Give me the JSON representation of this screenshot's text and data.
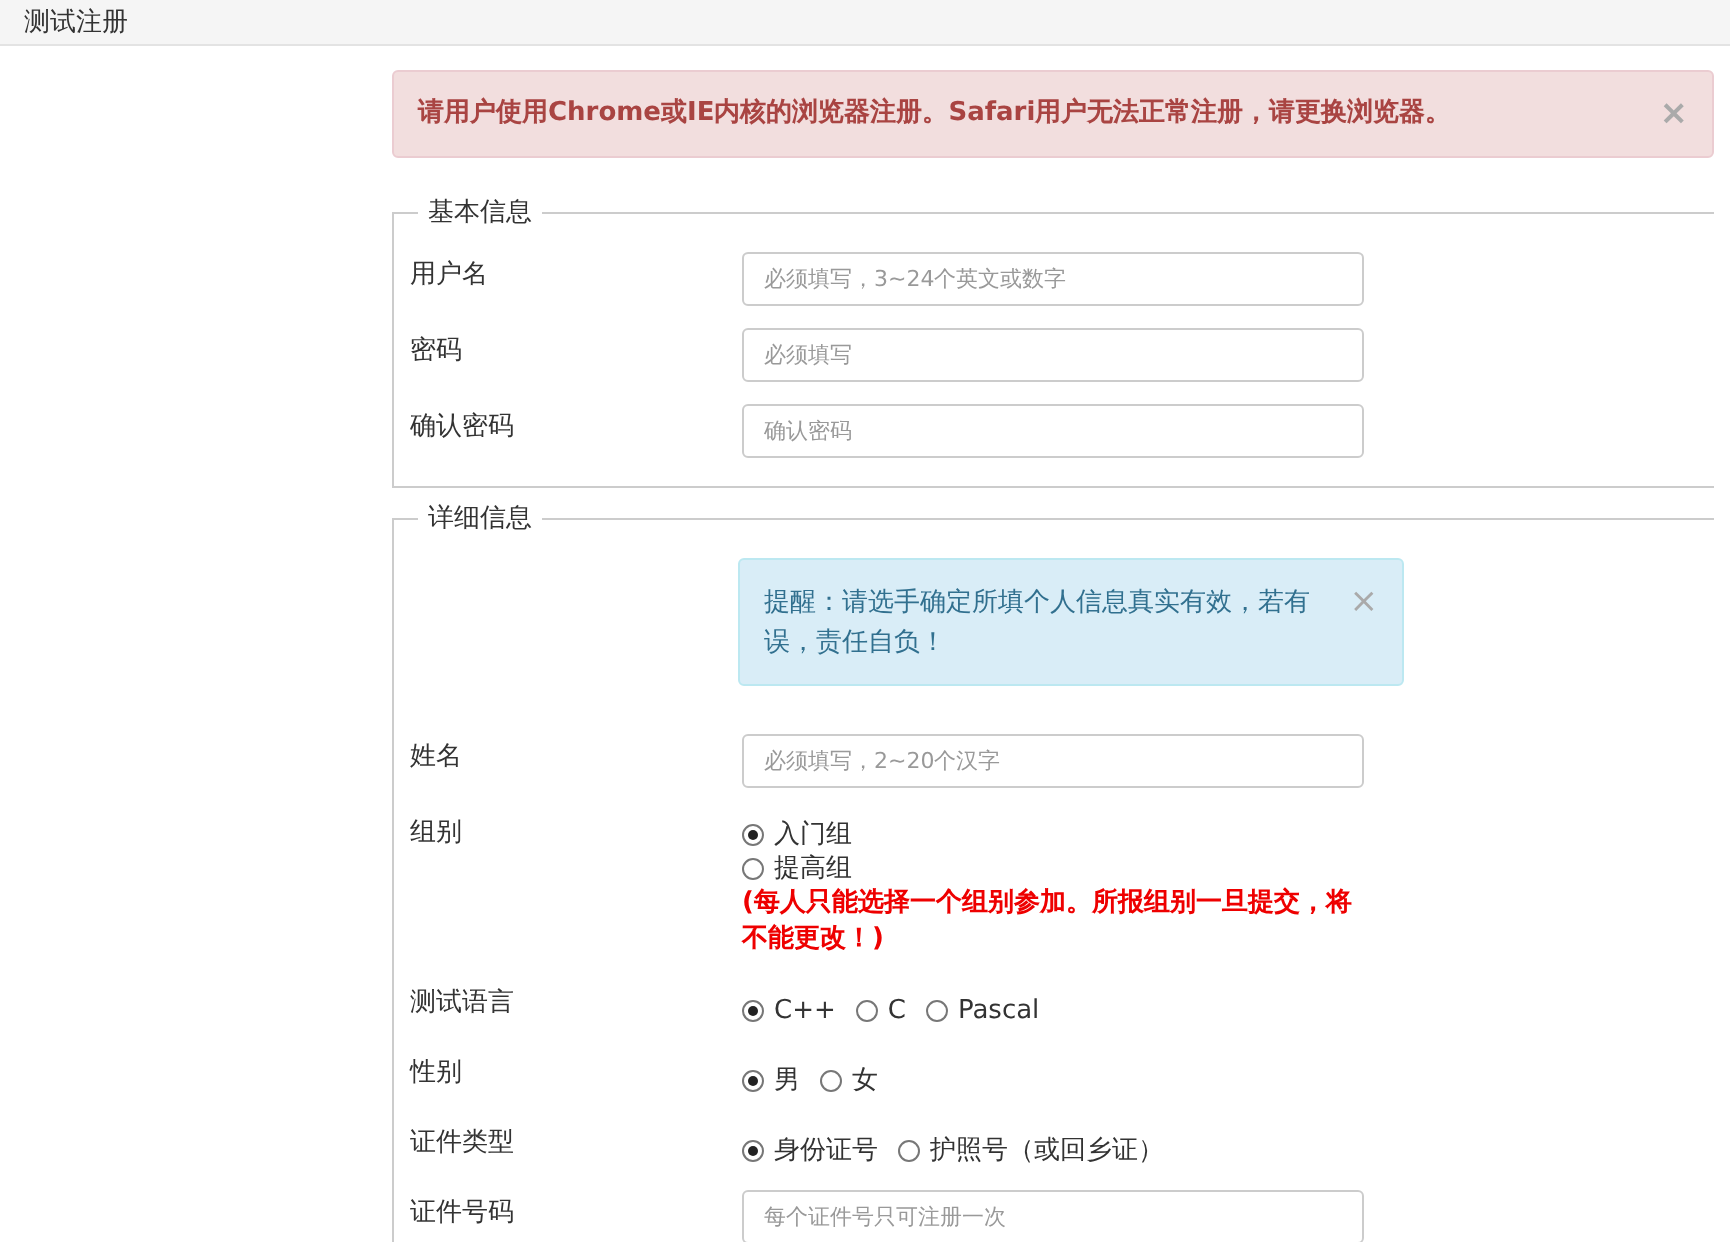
{
  "header": {
    "title": "测试注册"
  },
  "alert": {
    "text": "请用户使用Chrome或IE内核的浏览器注册。Safari用户无法正常注册，请更换浏览器。",
    "close": "×"
  },
  "sections": [
    {
      "legend": "基本信息",
      "rows": [
        {
          "kind": "text",
          "label": "用户名",
          "placeholder": "必须填写，3~24个英文或数字"
        },
        {
          "kind": "text",
          "label": "密码",
          "placeholder": "必须填写"
        },
        {
          "kind": "text",
          "label": "确认密码",
          "placeholder": "确认密码"
        }
      ]
    },
    {
      "legend": "详细信息",
      "notice": {
        "text": "提醒：请选手确定所填个人信息真实有效，若有误，责任自负！",
        "close": "×"
      },
      "rows": [
        {
          "kind": "text",
          "label": "姓名",
          "placeholder": "必须填写，2~20个汉字"
        },
        {
          "kind": "stacked",
          "label": "组别",
          "options": [
            {
              "label": "入门组",
              "selected": true
            },
            {
              "label": "提高组",
              "selected": false
            }
          ],
          "warning": "(每人只能选择一个组别参加。所报组别一旦提交，将不能更改！)"
        },
        {
          "kind": "radio",
          "label": "测试语言",
          "options": [
            {
              "label": "C++",
              "selected": true
            },
            {
              "label": "C",
              "selected": false
            },
            {
              "label": "Pascal",
              "selected": false
            }
          ]
        },
        {
          "kind": "radio",
          "label": "性别",
          "options": [
            {
              "label": "男",
              "selected": true
            },
            {
              "label": "女",
              "selected": false
            }
          ]
        },
        {
          "kind": "radio",
          "label": "证件类型",
          "options": [
            {
              "label": "身份证号",
              "selected": true
            },
            {
              "label": "护照号（或回乡证）",
              "selected": false
            }
          ]
        },
        {
          "kind": "text",
          "label": "证件号码",
          "placeholder": "每个证件号只可注册一次"
        }
      ]
    }
  ]
}
